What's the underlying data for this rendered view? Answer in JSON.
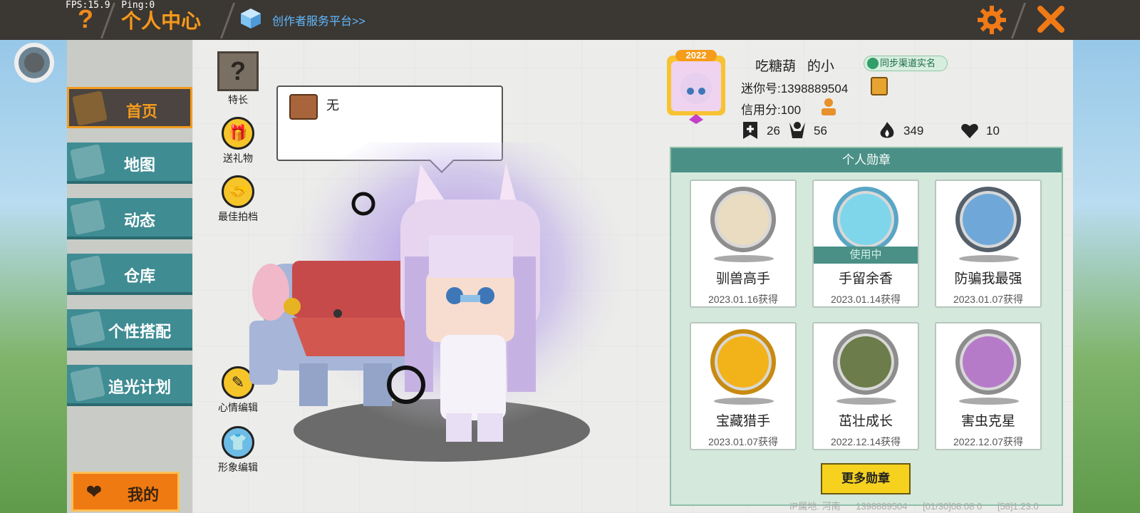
{
  "topbar": {
    "fps": "FPS:15.9",
    "ping": "Ping:0",
    "title": "个人中心",
    "creator_link": "创作者服务平台>>"
  },
  "leftnav": {
    "items": [
      {
        "label": "首页",
        "active": true
      },
      {
        "label": "地图"
      },
      {
        "label": "动态"
      },
      {
        "label": "仓库"
      },
      {
        "label": "个性搭配"
      },
      {
        "label": "追光计划"
      }
    ],
    "mine_label": "我的"
  },
  "actions": {
    "talent": "特长",
    "gift": "送礼物",
    "partner": "最佳拍档",
    "mood_edit": "心情编辑",
    "image_edit": "形象编辑"
  },
  "speech": {
    "text": "无"
  },
  "profile": {
    "frame_year": "2022",
    "username": "吃糖葫   的小",
    "sync_label": "同步渠道实名",
    "mini_id": "迷你号:1398889504",
    "credit": "信用分:100",
    "stats": {
      "follows": "26",
      "fans": "56",
      "popularity": "349",
      "likes": "10"
    }
  },
  "medals": {
    "header": "个人勋章",
    "in_use_label": "使用中",
    "items": [
      {
        "name": "驯兽高手",
        "date": "2023.01.16获得",
        "color": "#e9dcc0"
      },
      {
        "name": "手留余香",
        "date": "2023.01.14获得",
        "color": "#7fd6ea",
        "in_use": true
      },
      {
        "name": "防骗我最强",
        "date": "2023.01.07获得",
        "color": "#6fa8d8"
      },
      {
        "name": "宝藏猎手",
        "date": "2023.01.07获得",
        "color": "#f2b21a"
      },
      {
        "name": "茁壮成长",
        "date": "2022.12.14获得",
        "color": "#6c7c4a"
      },
      {
        "name": "害虫克星",
        "date": "2022.12.07获得",
        "color": "#b67bc8"
      }
    ],
    "more_label": "更多勋章"
  },
  "footer": {
    "ip": "IP属地: 河南",
    "id": "1398889504",
    "time": "[01/30]08:08 0",
    "version": "[58]1.23.0"
  }
}
